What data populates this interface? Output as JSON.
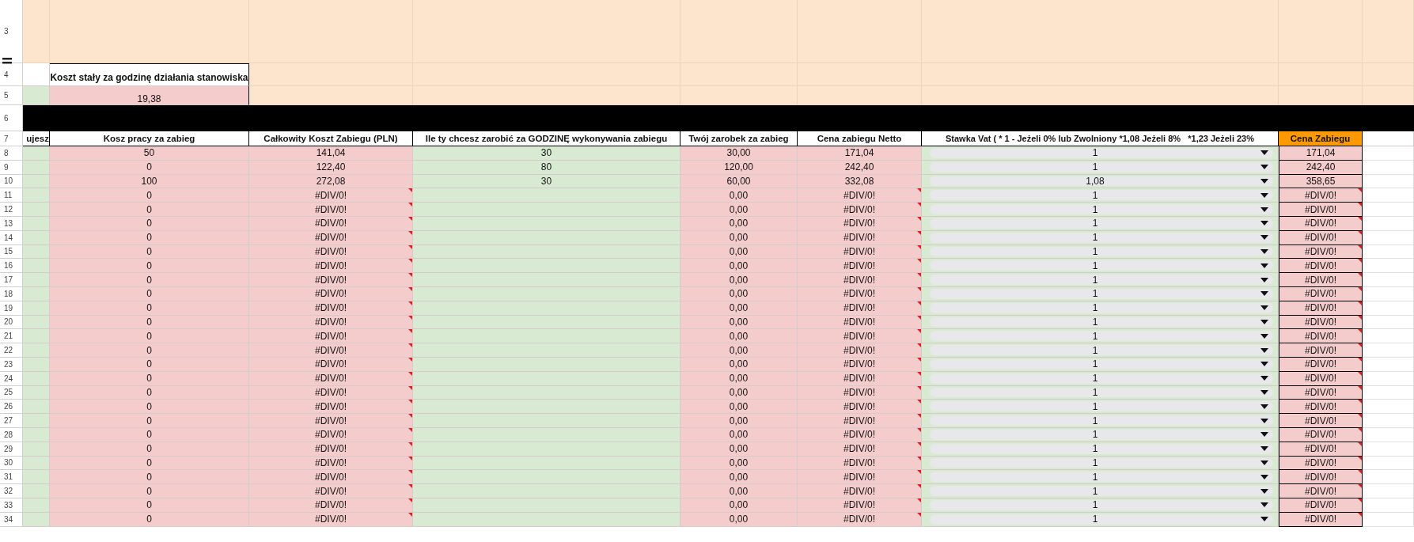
{
  "top_rows": [
    {
      "number": "3",
      "kind": "blank"
    },
    {
      "number": "4",
      "kind": "label",
      "text": "Koszt stały za godzinę działania stanowiska"
    },
    {
      "number": "5",
      "kind": "value",
      "text": "19,38"
    },
    {
      "number": "6",
      "kind": "divider"
    }
  ],
  "header_row": {
    "number": "7",
    "columns": [
      {
        "label": "ujesz",
        "highlight": false
      },
      {
        "label": "Kosz pracy za zabieg",
        "highlight": false
      },
      {
        "label": "Całkowity Koszt Zabiegu (PLN)",
        "highlight": false
      },
      {
        "label": "Ile ty chcesz zarobić za GODZINĘ wykonywania zabiegu",
        "highlight": false
      },
      {
        "label": "Twój zarobek za zabieg",
        "highlight": false
      },
      {
        "label": "Cena zabiegu Netto",
        "highlight": false
      },
      {
        "label": "Stawka Vat ( * 1 - Jeżeli 0% lub Zwolniony *1,08 Jeżeli 8%   *1,23 Jeżeli 23%",
        "highlight": false
      },
      {
        "label": "Cena Zabiegu",
        "highlight": true
      }
    ]
  },
  "rows": [
    {
      "number": "8",
      "labor": "50",
      "total": "141,04",
      "total_error": false,
      "hourly": "30",
      "earning": "30,00",
      "net": "171,04",
      "net_error": false,
      "vat": "1",
      "price": "171,04",
      "price_error": false
    },
    {
      "number": "9",
      "labor": "0",
      "total": "122,40",
      "total_error": false,
      "hourly": "80",
      "earning": "120,00",
      "net": "242,40",
      "net_error": false,
      "vat": "1",
      "price": "242,40",
      "price_error": false
    },
    {
      "number": "10",
      "labor": "100",
      "total": "272,08",
      "total_error": false,
      "hourly": "30",
      "earning": "60,00",
      "net": "332,08",
      "net_error": false,
      "vat": "1,08",
      "price": "358,65",
      "price_error": false
    },
    {
      "number": "11",
      "labor": "0",
      "total": "#DIV/0!",
      "total_error": true,
      "earning": "0,00",
      "net": "#DIV/0!",
      "net_error": true,
      "vat": "1",
      "price": "#DIV/0!",
      "price_error": true
    },
    {
      "number": "12",
      "labor": "0",
      "total": "#DIV/0!",
      "total_error": true,
      "earning": "0,00",
      "net": "#DIV/0!",
      "net_error": true,
      "vat": "1",
      "price": "#DIV/0!",
      "price_error": true
    },
    {
      "number": "13",
      "labor": "0",
      "total": "#DIV/0!",
      "total_error": true,
      "earning": "0,00",
      "net": "#DIV/0!",
      "net_error": true,
      "vat": "1",
      "price": "#DIV/0!",
      "price_error": true
    },
    {
      "number": "14",
      "labor": "0",
      "total": "#DIV/0!",
      "total_error": true,
      "earning": "0,00",
      "net": "#DIV/0!",
      "net_error": true,
      "vat": "1",
      "price": "#DIV/0!",
      "price_error": true
    },
    {
      "number": "15",
      "labor": "0",
      "total": "#DIV/0!",
      "total_error": true,
      "earning": "0,00",
      "net": "#DIV/0!",
      "net_error": true,
      "vat": "1",
      "price": "#DIV/0!",
      "price_error": true
    },
    {
      "number": "16",
      "labor": "0",
      "total": "#DIV/0!",
      "total_error": true,
      "earning": "0,00",
      "net": "#DIV/0!",
      "net_error": true,
      "vat": "1",
      "price": "#DIV/0!",
      "price_error": true
    },
    {
      "number": "17",
      "labor": "0",
      "total": "#DIV/0!",
      "total_error": true,
      "earning": "0,00",
      "net": "#DIV/0!",
      "net_error": true,
      "vat": "1",
      "price": "#DIV/0!",
      "price_error": true
    },
    {
      "number": "18",
      "labor": "0",
      "total": "#DIV/0!",
      "total_error": true,
      "earning": "0,00",
      "net": "#DIV/0!",
      "net_error": true,
      "vat": "1",
      "price": "#DIV/0!",
      "price_error": true
    },
    {
      "number": "19",
      "labor": "0",
      "total": "#DIV/0!",
      "total_error": true,
      "earning": "0,00",
      "net": "#DIV/0!",
      "net_error": true,
      "vat": "1",
      "price": "#DIV/0!",
      "price_error": true
    },
    {
      "number": "20",
      "labor": "0",
      "total": "#DIV/0!",
      "total_error": true,
      "earning": "0,00",
      "net": "#DIV/0!",
      "net_error": true,
      "vat": "1",
      "price": "#DIV/0!",
      "price_error": true
    },
    {
      "number": "21",
      "labor": "0",
      "total": "#DIV/0!",
      "total_error": true,
      "earning": "0,00",
      "net": "#DIV/0!",
      "net_error": true,
      "vat": "1",
      "price": "#DIV/0!",
      "price_error": true
    },
    {
      "number": "22",
      "labor": "0",
      "total": "#DIV/0!",
      "total_error": true,
      "earning": "0,00",
      "net": "#DIV/0!",
      "net_error": true,
      "vat": "1",
      "price": "#DIV/0!",
      "price_error": true
    },
    {
      "number": "23",
      "labor": "0",
      "total": "#DIV/0!",
      "total_error": true,
      "earning": "0,00",
      "net": "#DIV/0!",
      "net_error": true,
      "vat": "1",
      "price": "#DIV/0!",
      "price_error": true
    },
    {
      "number": "24",
      "labor": "0",
      "total": "#DIV/0!",
      "total_error": true,
      "earning": "0,00",
      "net": "#DIV/0!",
      "net_error": true,
      "vat": "1",
      "price": "#DIV/0!",
      "price_error": true
    },
    {
      "number": "25",
      "labor": "0",
      "total": "#DIV/0!",
      "total_error": true,
      "earning": "0,00",
      "net": "#DIV/0!",
      "net_error": true,
      "vat": "1",
      "price": "#DIV/0!",
      "price_error": true
    },
    {
      "number": "26",
      "labor": "0",
      "total": "#DIV/0!",
      "total_error": true,
      "earning": "0,00",
      "net": "#DIV/0!",
      "net_error": true,
      "vat": "1",
      "price": "#DIV/0!",
      "price_error": true
    },
    {
      "number": "27",
      "labor": "0",
      "total": "#DIV/0!",
      "total_error": true,
      "earning": "0,00",
      "net": "#DIV/0!",
      "net_error": true,
      "vat": "1",
      "price": "#DIV/0!",
      "price_error": true
    },
    {
      "number": "28",
      "labor": "0",
      "total": "#DIV/0!",
      "total_error": true,
      "earning": "0,00",
      "net": "#DIV/0!",
      "net_error": true,
      "vat": "1",
      "price": "#DIV/0!",
      "price_error": true
    },
    {
      "number": "29",
      "labor": "0",
      "total": "#DIV/0!",
      "total_error": true,
      "earning": "0,00",
      "net": "#DIV/0!",
      "net_error": true,
      "vat": "1",
      "price": "#DIV/0!",
      "price_error": true
    },
    {
      "number": "30",
      "labor": "0",
      "total": "#DIV/0!",
      "total_error": true,
      "earning": "0,00",
      "net": "#DIV/0!",
      "net_error": true,
      "vat": "1",
      "price": "#DIV/0!",
      "price_error": true
    },
    {
      "number": "31",
      "labor": "0",
      "total": "#DIV/0!",
      "total_error": true,
      "earning": "0,00",
      "net": "#DIV/0!",
      "net_error": true,
      "vat": "1",
      "price": "#DIV/0!",
      "price_error": true
    },
    {
      "number": "32",
      "labor": "0",
      "total": "#DIV/0!",
      "total_error": true,
      "earning": "0,00",
      "net": "#DIV/0!",
      "net_error": true,
      "vat": "1",
      "price": "#DIV/0!",
      "price_error": true
    },
    {
      "number": "33",
      "labor": "0",
      "total": "#DIV/0!",
      "total_error": true,
      "earning": "0,00",
      "net": "#DIV/0!",
      "net_error": true,
      "vat": "1",
      "price": "#DIV/0!",
      "price_error": true
    },
    {
      "number": "34",
      "labor": "0",
      "total": "#DIV/0!",
      "total_error": true,
      "earning": "0,00",
      "net": "#DIV/0!",
      "net_error": true,
      "vat": "1",
      "price": "#DIV/0!",
      "price_error": true
    }
  ]
}
